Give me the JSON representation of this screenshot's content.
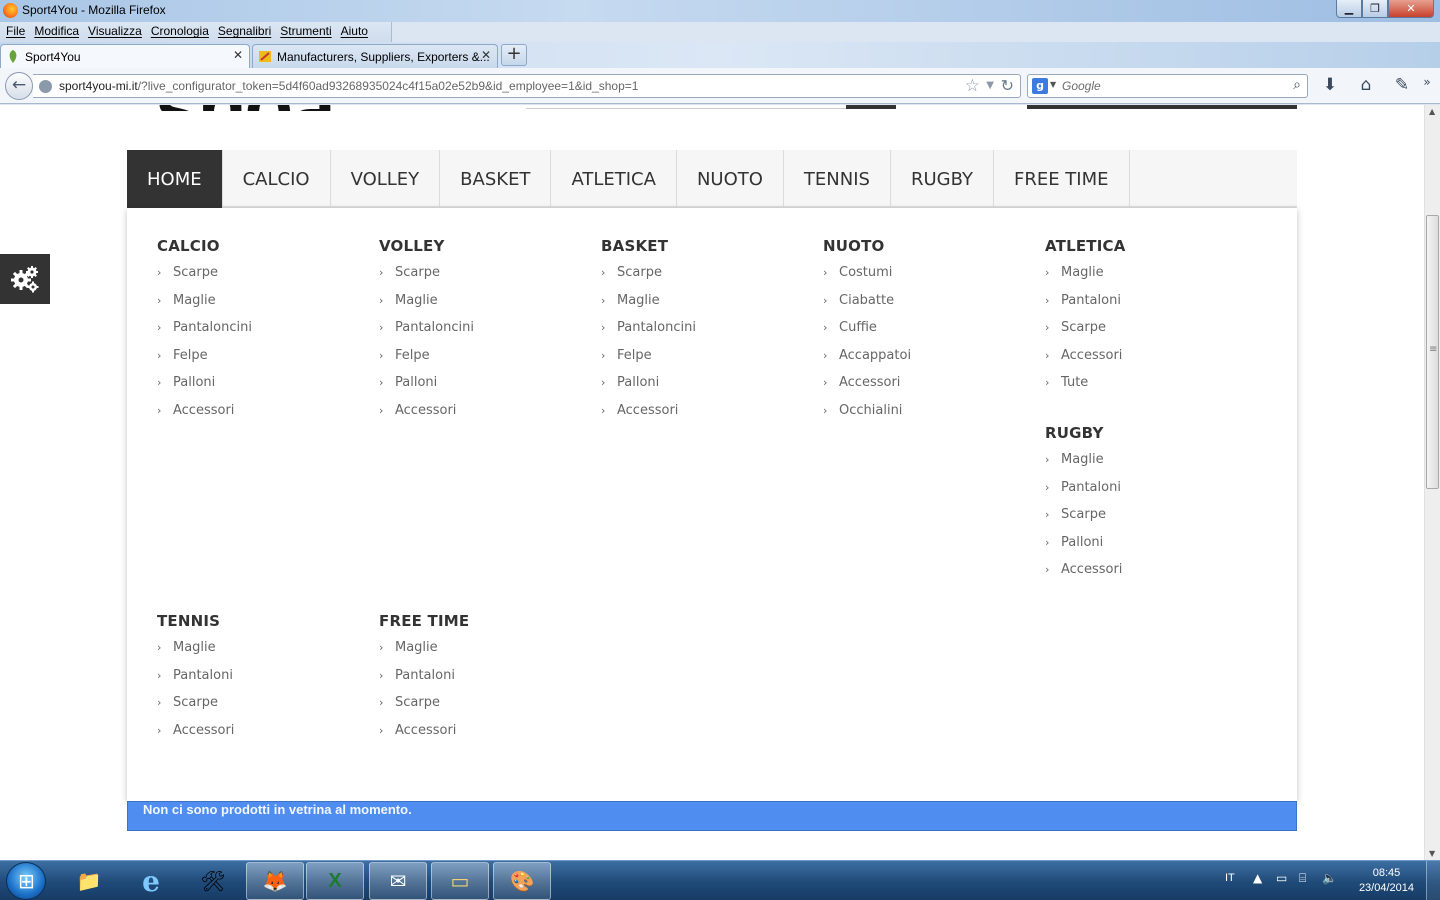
{
  "window": {
    "title": "Sport4You - Mozilla Firefox",
    "minimize": "▁",
    "maximize": "❐",
    "close": "✕"
  },
  "menubar": [
    "File",
    "Modifica",
    "Visualizza",
    "Cronologia",
    "Segnalibri",
    "Strumenti",
    "Aiuto"
  ],
  "tabs": [
    {
      "label": "Sport4You",
      "close": "✕"
    },
    {
      "label": "Manufacturers, Suppliers, Exporters &...",
      "close": "✕"
    }
  ],
  "newtab": "+",
  "navbar": {
    "back": "←",
    "url_host": "sport4you-mi.it",
    "url_path": "/?live_configurator_token=5d4f60ad93268935024c4f15a02e52b9&id_employee=1&id_shop=1",
    "star": "☆",
    "reload": "↻",
    "search_engine": "g",
    "search_placeholder": "Google",
    "search_icon": "⌕",
    "download_icon": "⬇",
    "home_icon": "⌂",
    "addon_icon": "✎"
  },
  "page": {
    "logo_text": "shoa",
    "nav": [
      "HOME",
      "CALCIO",
      "VOLLEY",
      "BASKET",
      "ATLETICA",
      "NUOTO",
      "TENNIS",
      "RUGBY",
      "FREE TIME"
    ],
    "active_nav": "HOME",
    "chevron": "›",
    "menu_columns": [
      {
        "title": "CALCIO",
        "items": [
          "Scarpe",
          "Maglie",
          "Pantaloncini",
          "Felpe",
          "Palloni",
          "Accessori"
        ]
      },
      {
        "title": "VOLLEY",
        "items": [
          "Scarpe",
          "Maglie",
          "Pantaloncini",
          "Felpe",
          "Palloni",
          "Accessori"
        ]
      },
      {
        "title": "BASKET",
        "items": [
          "Scarpe",
          "Maglie",
          "Pantaloncini",
          "Felpe",
          "Palloni",
          "Accessori"
        ]
      },
      {
        "title": "NUOTO",
        "items": [
          "Costumi",
          "Ciabatte",
          "Cuffie",
          "Accappatoi",
          "Accessori",
          "Occhialini"
        ]
      },
      {
        "title": "ATLETICA",
        "items": [
          "Maglie",
          "Pantaloni",
          "Scarpe",
          "Accessori",
          "Tute"
        ]
      },
      {
        "title": "RUGBY",
        "items": [
          "Maglie",
          "Pantaloni",
          "Scarpe",
          "Palloni",
          "Accessori"
        ]
      },
      {
        "title": "TENNIS",
        "items": [
          "Maglie",
          "Pantaloni",
          "Scarpe",
          "Accessori"
        ]
      },
      {
        "title": "FREE TIME",
        "items": [
          "Maglie",
          "Pantaloni",
          "Scarpe",
          "Accessori"
        ]
      }
    ],
    "notice": "Non ci sono prodotti in vetrina al momento.",
    "colors": {
      "nav_active_bg": "#333333",
      "notice_bg": "#4f8ef0"
    }
  },
  "taskbar": {
    "start": "⊞",
    "apps": [
      {
        "name": "explorer",
        "glyph": "📁",
        "running": false
      },
      {
        "name": "internet-explorer",
        "glyph": "e",
        "running": false
      },
      {
        "name": "app-tool",
        "glyph": "🛠",
        "running": false
      },
      {
        "name": "firefox",
        "glyph": "🦊",
        "running": true
      },
      {
        "name": "excel",
        "glyph": "X",
        "running": true
      },
      {
        "name": "app-drawing",
        "glyph": "✉",
        "running": true
      },
      {
        "name": "app-window",
        "glyph": "▭",
        "running": true
      },
      {
        "name": "paint",
        "glyph": "🎨",
        "running": true
      }
    ],
    "language": "IT",
    "time": "08:45",
    "date": "23/04/2014"
  }
}
